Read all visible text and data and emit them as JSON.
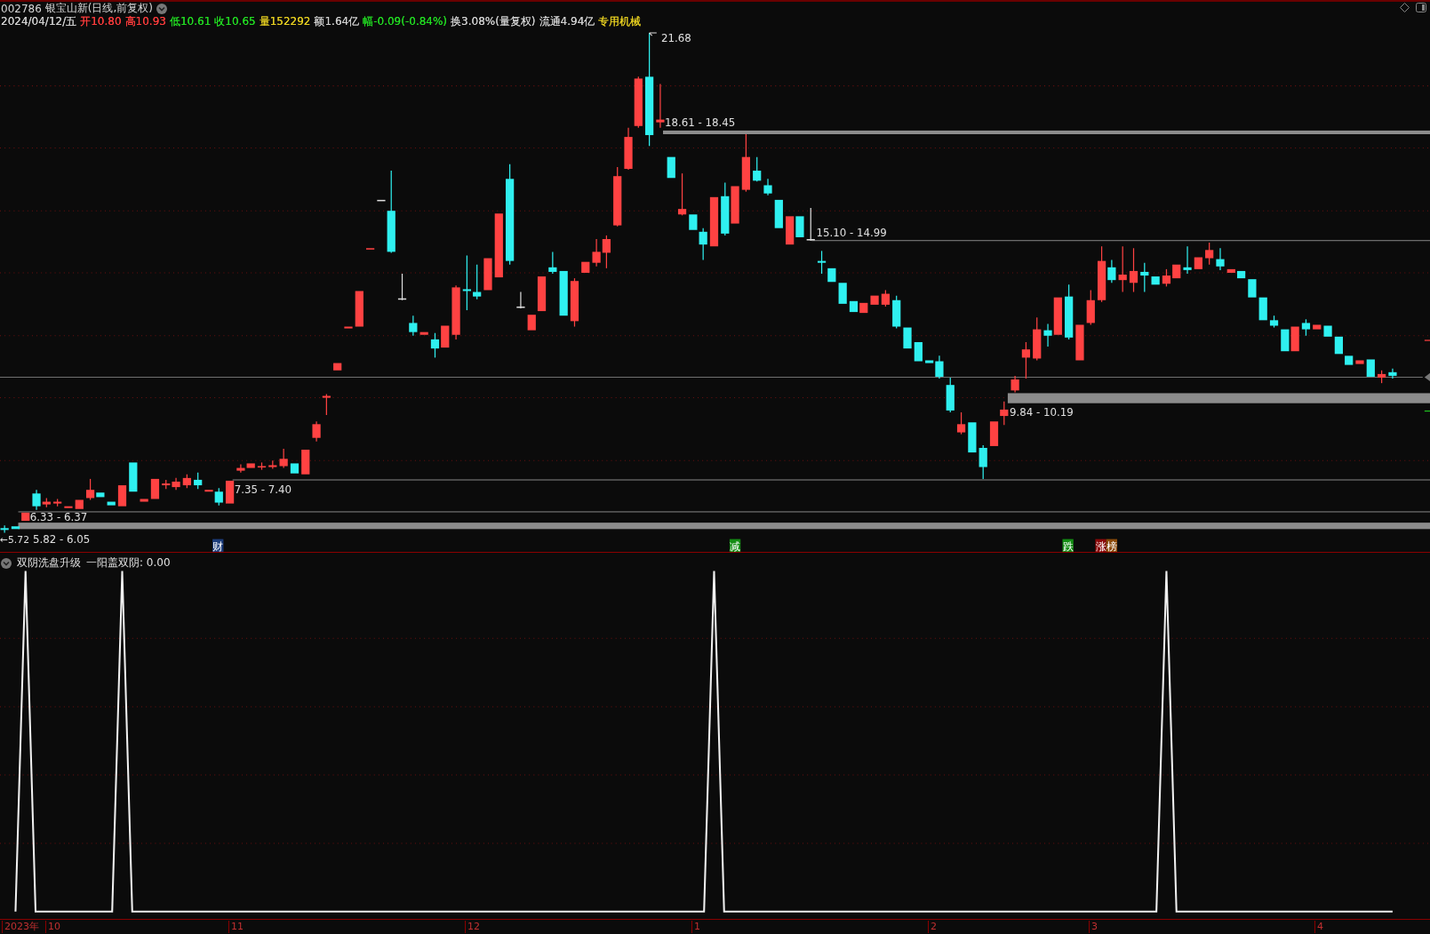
{
  "title": {
    "code": "002786",
    "name": "银宝山新(日线,前复权)"
  },
  "quote": [
    {
      "text": "2024/04/12/五",
      "color": "#d0d0d0"
    },
    {
      "text": "开10.80",
      "color": "#ff3c3c"
    },
    {
      "text": "高10.93",
      "color": "#ff3c3c"
    },
    {
      "text": "低10.61",
      "color": "#22dd22"
    },
    {
      "text": "收10.65",
      "color": "#22dd22"
    },
    {
      "text": "量152292",
      "color": "#e8d020"
    },
    {
      "text": "额1.64亿",
      "color": "#d0d0d0"
    },
    {
      "text": "幅-0.09(-0.84%)",
      "color": "#22dd22"
    },
    {
      "text": "换3.08%(量复权)",
      "color": "#d0d0d0"
    },
    {
      "text": "流通4.94亿",
      "color": "#d0d0d0"
    },
    {
      "text": "专用机械",
      "color": "#e8d020"
    }
  ],
  "price_labels": [
    {
      "text": "21.68"
    },
    {
      "text": "18.61 - 18.45"
    },
    {
      "text": "15.10 - 14.99"
    },
    {
      "text": "9.84 - 10.19"
    },
    {
      "text": "7.35 - 7.40"
    },
    {
      "text": "6.33 - 6.37"
    },
    {
      "text": "←5.72"
    },
    {
      "text": "5.82 - 6.05"
    }
  ],
  "events": [
    {
      "text": "财",
      "color": "#1c3c7a"
    },
    {
      "text": "减",
      "color": "#148c14"
    },
    {
      "text": "跌",
      "color": "#148c14"
    },
    {
      "text": "涨",
      "color": "#8b0a0a"
    },
    {
      "text": "榜",
      "color": "#8b4a0a"
    }
  ],
  "indicator": {
    "name": "双阴洗盘升级",
    "reading": "一阳盖双阴: 0.00"
  },
  "axis_labels": [
    "2023年",
    "10",
    "11",
    "12",
    "1",
    "2",
    "3",
    "4"
  ]
}
